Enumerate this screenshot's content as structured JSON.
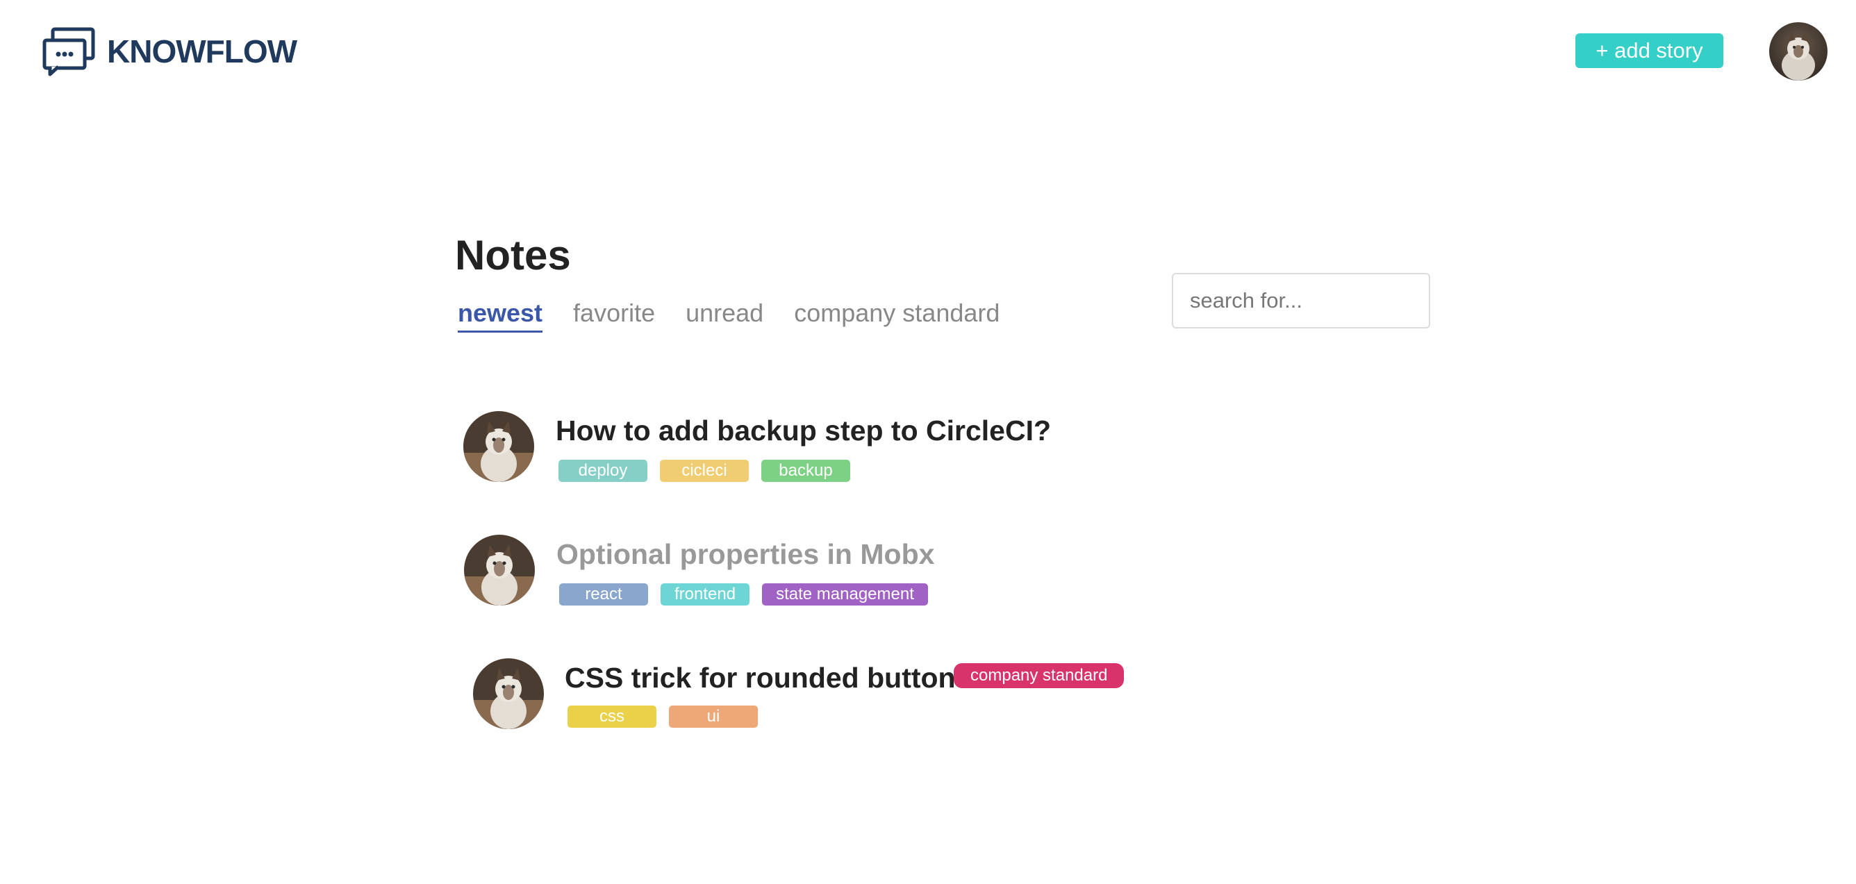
{
  "header": {
    "brand": "KNOWFLOW",
    "logo_icon": "chat-bubbles-icon",
    "add_story_label": "+ add story",
    "avatar_icon": "cat-avatar"
  },
  "main": {
    "title": "Notes",
    "tabs": [
      {
        "label": "newest",
        "active": true
      },
      {
        "label": "favorite",
        "active": false
      },
      {
        "label": "unread",
        "active": false
      },
      {
        "label": "company standard",
        "active": false
      }
    ],
    "search": {
      "placeholder": "search for..."
    }
  },
  "notes": [
    {
      "title": "How to add backup step to CircleCI?",
      "read": false,
      "tags": [
        {
          "label": "deploy",
          "color": "#86cfc6"
        },
        {
          "label": "cicleci",
          "color": "#f0cd72"
        },
        {
          "label": "backup",
          "color": "#7dd184"
        }
      ]
    },
    {
      "title": "Optional properties in Mobx",
      "read": true,
      "tags": [
        {
          "label": "react",
          "color": "#8aa6cd"
        },
        {
          "label": "frontend",
          "color": "#6dd6d4"
        },
        {
          "label": "state management",
          "color": "#a062c4"
        }
      ]
    },
    {
      "title": "CSS trick for rounded buttons",
      "read": false,
      "badge": {
        "label": "company standard",
        "color": "#d8336a"
      },
      "tags": [
        {
          "label": "css",
          "color": "#ebd14a"
        },
        {
          "label": "ui",
          "color": "#eea776"
        }
      ]
    }
  ],
  "colors": {
    "accent": "#34cfc6",
    "active_tab": "#3a57a8",
    "brand": "#1f3a5c"
  }
}
